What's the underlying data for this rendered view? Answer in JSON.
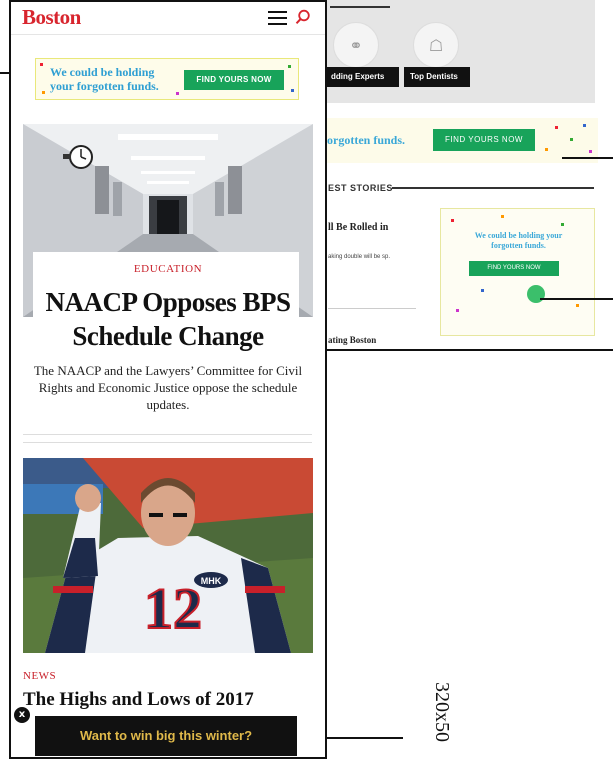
{
  "background_page": {
    "categories": [
      {
        "label": "Wedding Experts",
        "icon": "rings-icon",
        "display": "dding Experts"
      },
      {
        "label": "Top Dentists",
        "icon": "tooth-icon",
        "display": "Top Dentists"
      }
    ],
    "banner_text": "orgotten funds.",
    "banner_button": "FIND YOURS NOW",
    "latest_heading": "EST STORIES",
    "story1_title": "ll Be Rolled in",
    "story1_sub": "aking double will be sp.",
    "story2_title": "ating Boston",
    "side_ad_text": "We could be holding your forgotten funds.",
    "side_ad_button": "FIND YOURS NOW"
  },
  "header": {
    "logo": "Boston",
    "menu_icon": "hamburger-menu-icon",
    "search_icon": "search-icon"
  },
  "top_ad": {
    "text": "We could be holding your forgotten funds.",
    "button": "FIND YOURS NOW",
    "colors": {
      "text": "#2f9fd3",
      "button": "#18a35a"
    }
  },
  "lead_story": {
    "kicker": "EDUCATION",
    "headline": "NAACP Opposes BPS Schedule Change",
    "dek": "The NAACP and the Lawyers’ Committee for Civil Rights and Economic Justice oppose the schedule updates."
  },
  "second_story": {
    "kicker": "NEWS",
    "headline": "The Highs and Lows of 2017",
    "jersey_number": "12",
    "patch_text": "MHK"
  },
  "sticky_ad": {
    "text": "Want to win big this winter?",
    "close_label": "x"
  },
  "size_label": "320x50",
  "colors": {
    "brand": "#d8252e",
    "kicker": "#c8202a",
    "sticky_text": "#e0b94a"
  }
}
